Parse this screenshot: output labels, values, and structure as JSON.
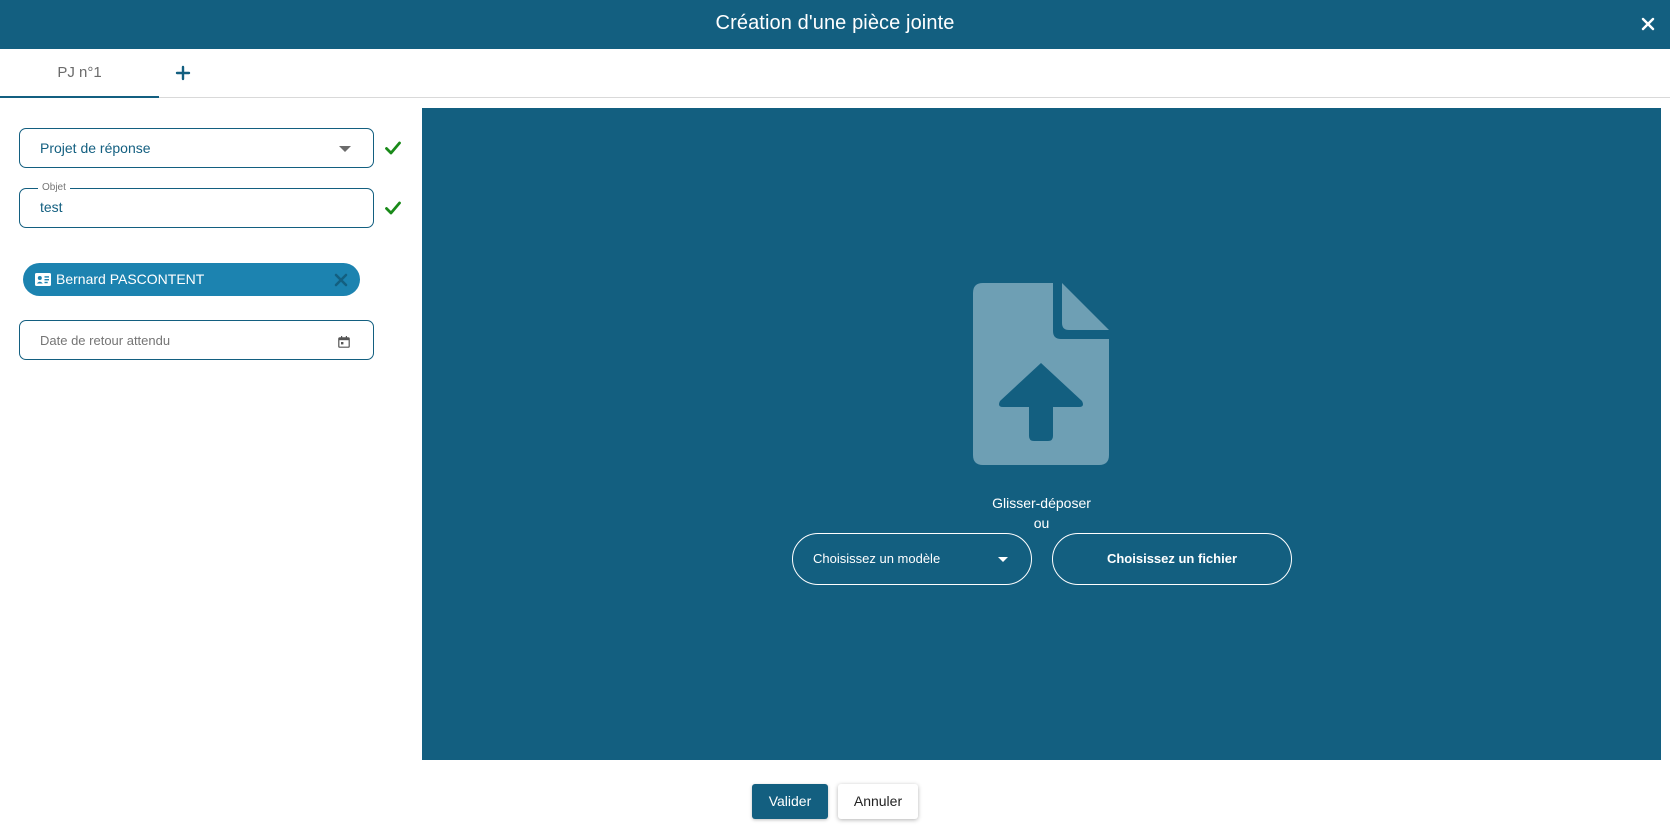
{
  "dialog": {
    "title": "Création d'une pièce jointe",
    "close_icon": "close-icon"
  },
  "tabs": [
    {
      "label": "PJ n°1",
      "active": true
    }
  ],
  "tab_add_icon": "plus-icon",
  "form": {
    "type_select": {
      "value": "Projet de réponse",
      "valid": true
    },
    "objet": {
      "label": "Objet",
      "value": "test",
      "valid": true
    },
    "recipient_chip": {
      "label": "Bernard PASCONTENT",
      "icon": "contact-card-icon"
    },
    "return_date": {
      "placeholder": "Date de retour attendu",
      "icon": "calendar-icon"
    }
  },
  "dropzone": {
    "icon": "file-upload-icon",
    "drag_text": "Glisser-déposer",
    "or_text": "ou",
    "model_select_placeholder": "Choisissez un modèle",
    "file_button_label": "Choisissez un fichier"
  },
  "actions": {
    "submit_label": "Valider",
    "cancel_label": "Annuler"
  },
  "colors": {
    "primary": "#135f80",
    "chip": "#1c83b0",
    "valid": "#1a8a1a"
  }
}
